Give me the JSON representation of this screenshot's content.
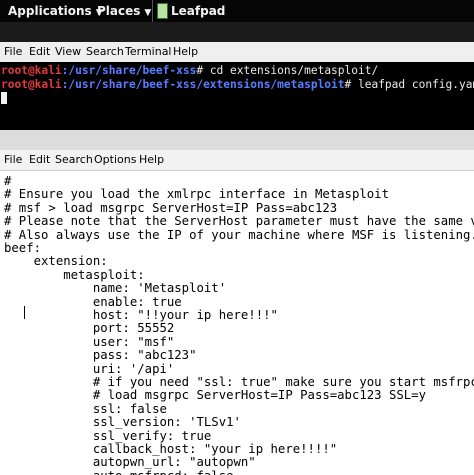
{
  "top_panel": {
    "applications": "Applications",
    "places": "Places",
    "leafpad_tab": "Leafpad"
  },
  "terminal": {
    "menu": [
      "File",
      "Edit",
      "View",
      "Search",
      "Terminal",
      "Help"
    ],
    "lines": [
      {
        "user": "root@kali",
        "path": ":/usr/share/beef-xss",
        "cmd": "# cd extensions/metasploit/"
      },
      {
        "user": "root@kali",
        "path": ":/usr/share/beef-xss/extensions/metasploit",
        "cmd": "# leafpad config.yaml"
      }
    ]
  },
  "leafpad": {
    "menu": [
      "File",
      "Edit",
      "Search",
      "Options",
      "Help"
    ],
    "lines": [
      "#",
      "# Ensure you load the xmlrpc interface in Metasploit",
      "# msf > load msgrpc ServerHost=IP Pass=abc123",
      "# Please note that the ServerHost parameter must have the same valu",
      "# Also always use the IP of your machine where MSF is listening.",
      "beef:",
      "    extension:",
      "        metasploit:",
      "            name: 'Metasploit'",
      "            enable: true",
      "            host: \"!!your ip here!!!\"",
      "            port: 55552",
      "            user: \"msf\"",
      "            pass: \"abc123\"",
      "            uri: '/api'",
      "            # if you need \"ssl: true\" make sure you start msfrpcd w",
      "            # load msgrpc ServerHost=IP Pass=abc123 SSL=y",
      "            ssl: false",
      "            ssl_version: 'TLSv1'",
      "            ssl_verify: true",
      "            callback_host: \"your ip here!!!!\"",
      "            autopwn_url: \"autopwn\"",
      "            auto_msfrpcd: false"
    ]
  }
}
